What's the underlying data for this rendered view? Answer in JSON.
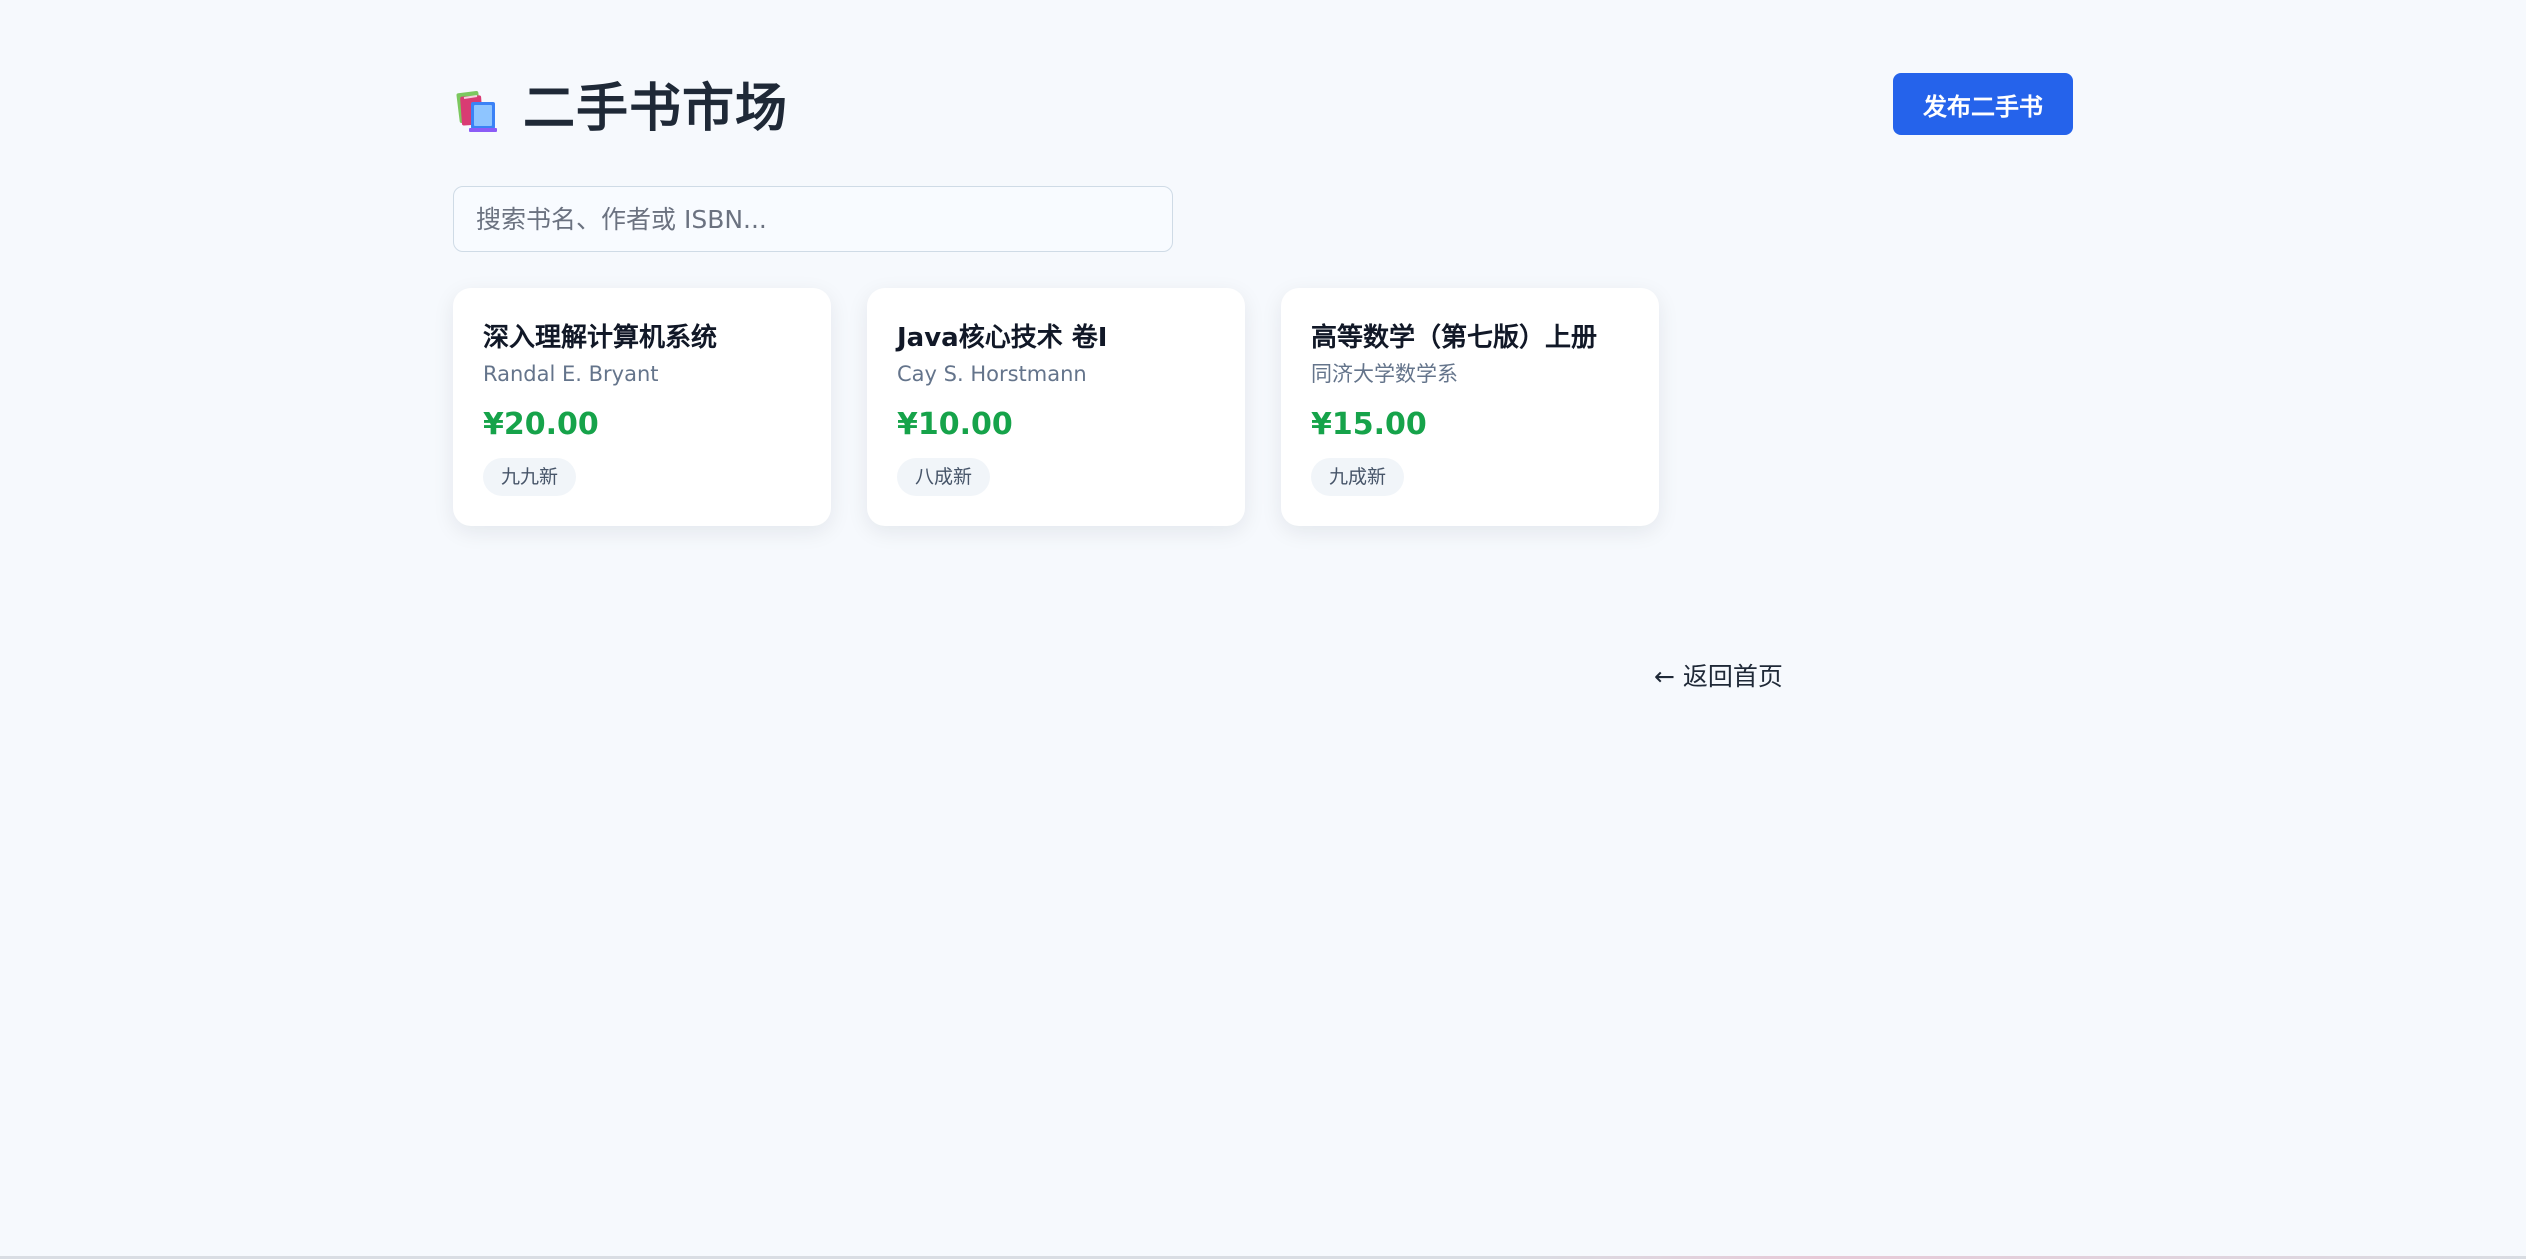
{
  "header": {
    "title": "二手书市场",
    "icon": "books-icon",
    "publish_button": "发布二手书"
  },
  "search": {
    "placeholder": "搜索书名、作者或 ISBN..."
  },
  "books": [
    {
      "title": "深入理解计算机系统",
      "author": "Randal E. Bryant",
      "price": "¥20.00",
      "condition": "九九新"
    },
    {
      "title": "Java核心技术 卷I",
      "author": "Cay S. Horstmann",
      "price": "¥10.00",
      "condition": "八成新"
    },
    {
      "title": "高等数学（第七版）上册",
      "author": "同济大学数学系",
      "price": "¥15.00",
      "condition": "九成新"
    }
  ],
  "footer": {
    "back_link": "← 返回首页"
  },
  "colors": {
    "background": "#f6f9fd",
    "primary": "#2563eb",
    "price": "#16a34a",
    "card": "#ffffff",
    "muted_text": "#64748b"
  }
}
